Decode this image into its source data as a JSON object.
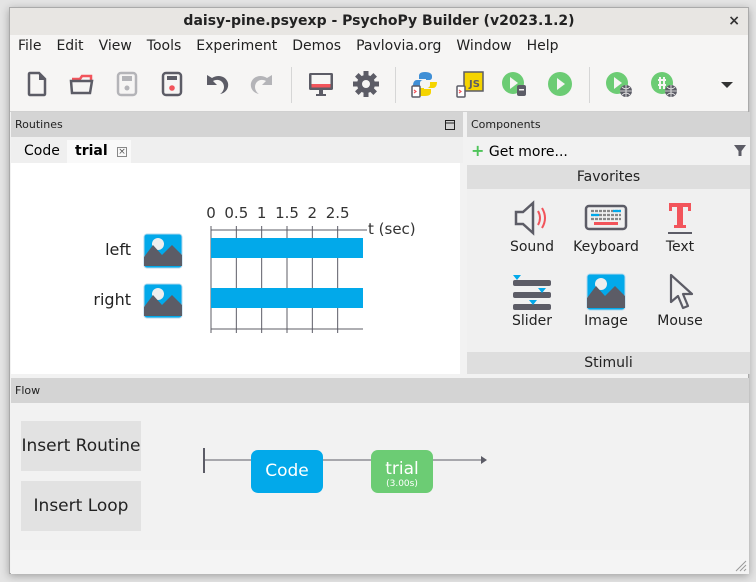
{
  "window": {
    "title": "daisy-pine.psyexp - PsychoPy Builder (v2023.1.2)",
    "close_label": "×"
  },
  "menu": [
    "File",
    "Edit",
    "View",
    "Tools",
    "Experiment",
    "Demos",
    "Pavlovia.org",
    "Window",
    "Help"
  ],
  "toolbar": {
    "buttons": [
      {
        "name": "new-file",
        "enabled": true
      },
      {
        "name": "open-folder",
        "enabled": true
      },
      {
        "name": "save",
        "enabled": false
      },
      {
        "name": "save-as",
        "enabled": true
      },
      {
        "name": "undo",
        "enabled": true
      },
      {
        "name": "redo",
        "enabled": false
      },
      {
        "name": "monitor-center",
        "enabled": true
      },
      {
        "name": "experiment-settings",
        "enabled": true
      },
      {
        "name": "compile-python",
        "enabled": true
      },
      {
        "name": "compile-js",
        "enabled": true
      },
      {
        "name": "runner",
        "enabled": true
      },
      {
        "name": "run",
        "enabled": true
      },
      {
        "name": "run-online",
        "enabled": true
      },
      {
        "name": "pilot-online",
        "enabled": true
      }
    ],
    "colors": {
      "icon_gray": "#5c5c66",
      "accent_red": "#f2545b",
      "run_green": "#6ccc74",
      "js_yellow": "#f5d400",
      "python_blue": "#3f8fd6"
    }
  },
  "routines": {
    "header": "Routines",
    "tabs": [
      {
        "label": "Code",
        "active": false
      },
      {
        "label": "trial",
        "active": true,
        "close": "×"
      }
    ],
    "timeline": {
      "axis_label": "t (sec)",
      "ticks": [
        "0",
        "0.5",
        "1",
        "1.5",
        "2",
        "2.5"
      ],
      "tmax": 3.0,
      "components": [
        {
          "name": "left",
          "type": "image",
          "start": 0,
          "stop": 3.0
        },
        {
          "name": "right",
          "type": "image",
          "start": 0,
          "stop": 3.0
        }
      ],
      "bar_color": "#02a9ea"
    }
  },
  "components": {
    "header": "Components",
    "get_more": "Get more...",
    "favorites_label": "Favorites",
    "favorites": [
      "Sound",
      "Keyboard",
      "Text",
      "Slider",
      "Image",
      "Mouse"
    ],
    "next_category": "Stimuli"
  },
  "flow": {
    "header": "Flow",
    "insert_routine": "Insert Routine",
    "insert_loop": "Insert Loop",
    "routines": [
      {
        "label": "Code",
        "duration": "",
        "color": "#02a9ea"
      },
      {
        "label": "trial",
        "duration": "(3.00s)",
        "color": "#6ccc74"
      }
    ]
  }
}
